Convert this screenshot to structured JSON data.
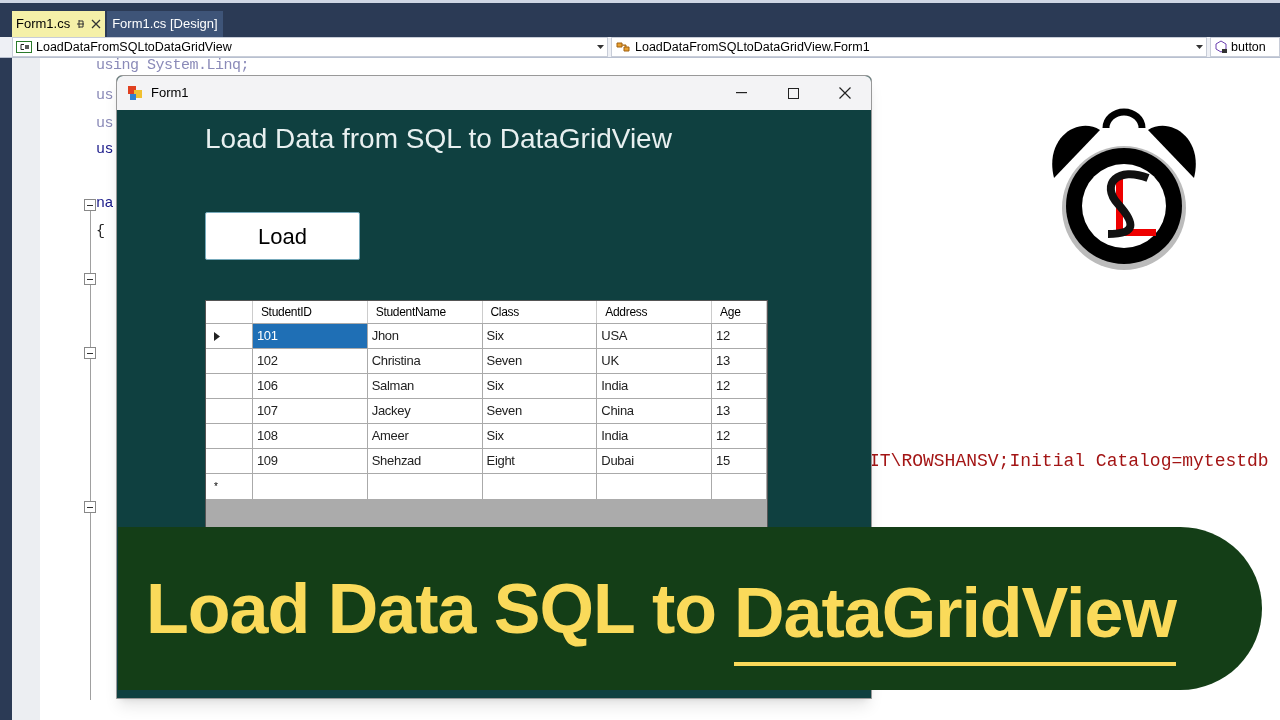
{
  "tabs": [
    {
      "label": "Form1.cs",
      "selected": true
    },
    {
      "label": "Form1.cs [Design]",
      "selected": false
    }
  ],
  "nav_bar": {
    "project": "LoadDataFromSQLtoDataGridView",
    "class": "LoadDataFromSQLtoDataGridView.Form1",
    "member": "button"
  },
  "code_lines": [
    {
      "text": "using System.Linq;",
      "kind": "faded"
    },
    {
      "text": "us",
      "kind": "faded"
    },
    {
      "text": "us",
      "kind": "faded"
    },
    {
      "text": "us",
      "kind": "keyword"
    },
    {
      "text": "na",
      "kind": "keyword"
    },
    {
      "text": "{",
      "kind": "plain"
    }
  ],
  "code_fragment": "IT\\ROWSHANSV;Initial Catalog=mytestdb",
  "form": {
    "title": "Form1",
    "heading": "Load Data from SQL to DataGridView",
    "button": "Load",
    "grid": {
      "columns": [
        "StudentID",
        "StudentName",
        "Class",
        "Address",
        "Age"
      ],
      "rows": [
        {
          "cells": [
            "101",
            "Jhon",
            "Six",
            "USA",
            "12"
          ],
          "selected": true
        },
        {
          "cells": [
            "102",
            "Christina",
            "Seven",
            "UK",
            "13"
          ],
          "selected": false
        },
        {
          "cells": [
            "106",
            "Salman",
            "Six",
            "India",
            "12"
          ],
          "selected": false
        },
        {
          "cells": [
            "107",
            "Jackey",
            "Seven",
            "China",
            "13"
          ],
          "selected": false
        },
        {
          "cells": [
            "108",
            "Ameer",
            "Six",
            "India",
            "12"
          ],
          "selected": false
        },
        {
          "cells": [
            "109",
            "Shehzad",
            "Eight",
            "Dubai",
            "15"
          ],
          "selected": false
        }
      ],
      "new_row_marker": "*"
    }
  },
  "banner": {
    "parts": [
      {
        "text": "Load Data SQL to",
        "underline": false
      },
      {
        "text": "DataGridView",
        "underline": true
      }
    ]
  }
}
